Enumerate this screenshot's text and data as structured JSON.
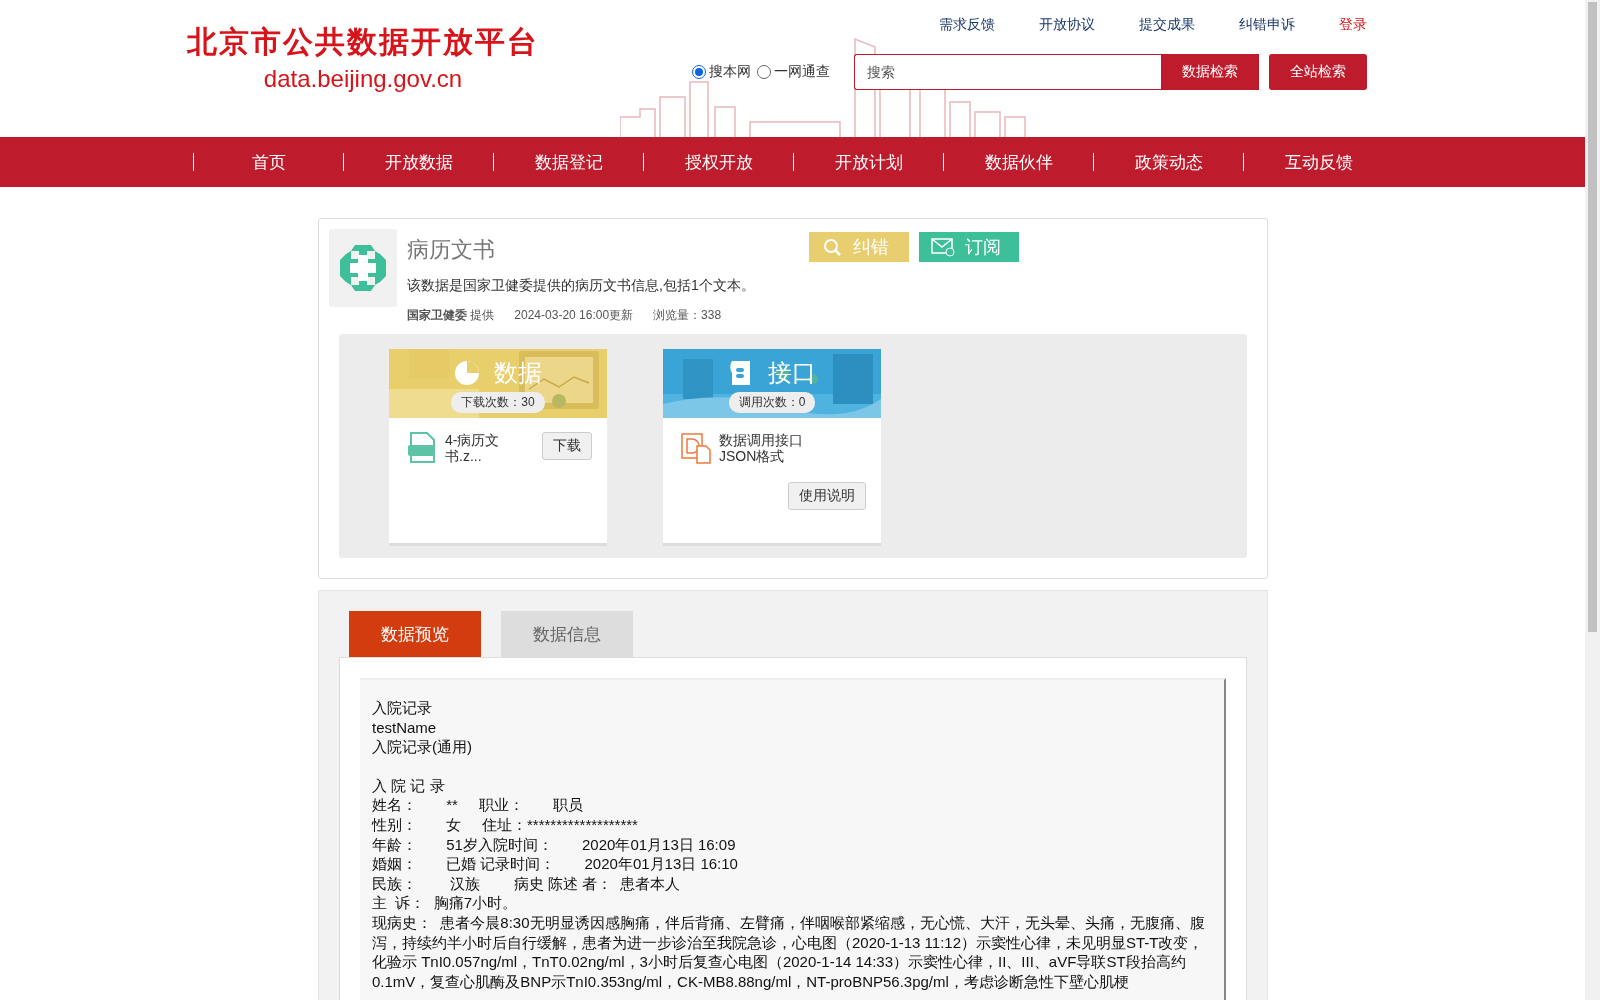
{
  "site": {
    "title": "北京市公共数据开放平台",
    "domain": "data.beijing.gov.cn"
  },
  "top_links": [
    {
      "label": "需求反馈",
      "kind": "link"
    },
    {
      "label": "开放协议",
      "kind": "link"
    },
    {
      "label": "提交成果",
      "kind": "link"
    },
    {
      "label": "纠错申诉",
      "kind": "link"
    },
    {
      "label": "登录",
      "kind": "login"
    }
  ],
  "search": {
    "scopes": [
      {
        "label": "搜本网",
        "selected": true
      },
      {
        "label": "一网通查",
        "selected": false
      }
    ],
    "placeholder": "搜索",
    "buttons": [
      "数据检索",
      "全站检索"
    ]
  },
  "nav": [
    {
      "label": "首页"
    },
    {
      "label": "开放数据"
    },
    {
      "label": "数据登记"
    },
    {
      "label": "授权开放"
    },
    {
      "label": "开放计划"
    },
    {
      "label": "数据伙伴"
    },
    {
      "label": "政策动态"
    },
    {
      "label": "互动反馈"
    }
  ],
  "dataset": {
    "title": "病历文书",
    "description": "该数据是国家卫健委提供的病历文书信息,包括1个文本。",
    "provider": "国家卫健委",
    "provider_suffix": "提供",
    "updated": "2024-03-20 16:00更新",
    "views_label": "浏览量：",
    "views": "338",
    "actions": [
      {
        "label": "纠错",
        "kind": "correct"
      },
      {
        "label": "订阅",
        "kind": "subscribe"
      }
    ]
  },
  "resources": [
    {
      "kind": "data",
      "title": "数据",
      "count": "下载次数：30",
      "item": "4-病历文书.z...",
      "buttons": [
        "下载"
      ]
    },
    {
      "kind": "api",
      "title": "接口",
      "count": "调用次数：0",
      "item": "数据调用接口",
      "item_sub": "JSON格式",
      "buttons": [
        "使用说明"
      ]
    }
  ],
  "tabs": [
    {
      "label": "数据预览",
      "selected": true
    },
    {
      "label": "数据信息",
      "selected": false
    }
  ],
  "preview": {
    "blocks": [
      [
        "入院记录",
        "testName",
        "入院记录(通用)"
      ],
      [
        "入 院 记 录",
        "姓名：       **     职业：       职员",
        "性别：       女     住址：*******************",
        "年龄：       51岁入院时间：       2020年01月13日 16:09",
        "婚姻：       已婚 记录时间：       2020年01月13日 16:10",
        "民族：        汉族        病史 陈述 者：  患者本人",
        "主  诉：  胸痛7小时。",
        "现病史：  患者今晨8:30无明显诱因感胸痛，伴后背痛、左臂痛，伴咽喉部紧缩感，无心慌、大汗，无头晕、头痛，无腹痛、腹泻，持续约半小时后自行缓解，患者为进一步诊治至我院急诊，心电图（2020-1-13 11:12）示窦性心律，未见明显ST-T改变，化验示 TnI0.057ng/ml，TnT0.02ng/ml，3小时后复查心电图（2020-1-14 14:33）示窦性心律，II、III、aVF导联ST段抬高约0.1mV，复查心肌酶及BNP示TnI0.353ng/ml，CK-MB8.88ng/ml，NT-proBNP56.3pg/ml，考虑诊断急性下壁心肌梗"
      ]
    ]
  }
}
